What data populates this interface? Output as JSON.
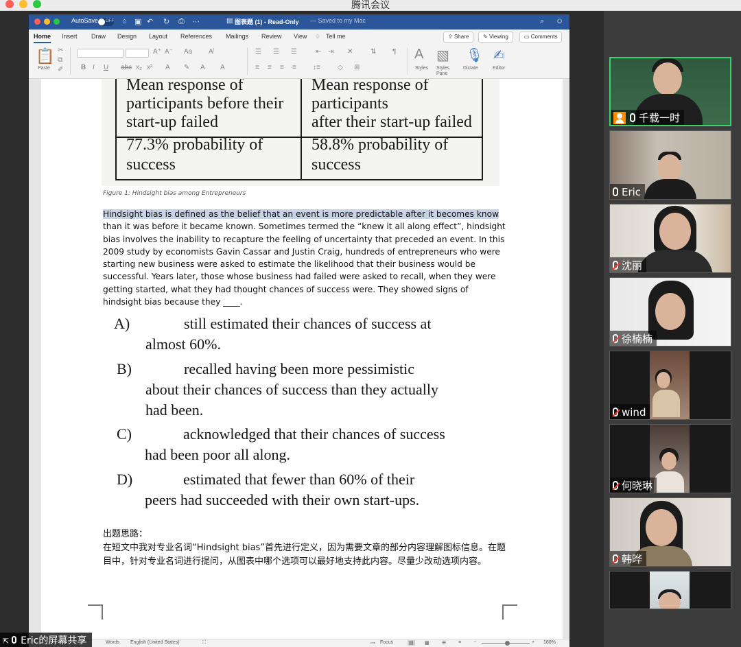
{
  "meeting": {
    "window_title": "腾讯会议",
    "share_label": "Eric的屏幕共享"
  },
  "word": {
    "autosave": "AutoSave",
    "autosave_state": "OFF",
    "doc_title": "图表题 (1)  -  Read-Only",
    "saved_state": "— Saved to my Mac",
    "tabs": [
      "Home",
      "Insert",
      "Draw",
      "Design",
      "Layout",
      "References",
      "Mailings",
      "Review",
      "View"
    ],
    "tell_me": "Tell me",
    "share_btn": "Share",
    "viewing_btn": "Viewing",
    "comments_btn": "Comments",
    "ribbon": {
      "paste": "Paste",
      "styles": "Styles",
      "styles_pane": "Styles\nPane",
      "dictate": "Dictate",
      "editor": "Editor"
    },
    "status": {
      "words": "Words",
      "language": "English (United States)",
      "focus": "Focus",
      "zoom": "180%"
    }
  },
  "document": {
    "table": {
      "before_header": "Mean response of\nparticipants before their\nstart-up failed",
      "after_header": "Mean response of\nparticipants\nafter their start-up failed",
      "before_value": "77.3% probability of\nsuccess",
      "after_value": "58.8% probability of\nsuccess"
    },
    "caption": "Figure 1: Hindsight bias among Entrepreneurs",
    "para_highlight": "Hindsight bias is defined as the belief that an event is more predictable after it becomes know",
    "para_rest": " than it was before it became known. Sometimes termed the “knew it all along effect”, hindsight bias involves the inability to recapture the feeling of uncertainty that preceded an event. In this 2009 study by economists Gavin Cassar and Justin Craig, hundreds of entrepreneurs who were starting new business were asked to estimate the likelihood that their business would be successful. Years later, those whose business had failed were asked to recall, when they were getting started, what they had thought chances of success were. They showed signs of hindsight bias because they ____.",
    "options": [
      {
        "letter": "A)",
        "line1": "still estimated their chances of success at",
        "line2": "almost 60%."
      },
      {
        "letter": "B)",
        "line1": "recalled having been more pessimistic",
        "line2": "about their chances of success than they actually",
        "line3": "had been."
      },
      {
        "letter": "C)",
        "line1": "acknowledged that their chances of success",
        "line2": "had been poor all along."
      },
      {
        "letter": "D)",
        "line1": "estimated that fewer than 60% of their",
        "line2": "peers had succeeded with their own start-ups."
      }
    ],
    "notes_title": "出题思路：",
    "notes_body": "在短文中我对专业名词“Hindsight bias”首先进行定义，因为需要文章的部分内容理解图标信息。在题目中，针对专业名词进行提问，从图表中哪个选项可以最好地支持此内容。尽量少改动选项内容。"
  },
  "participants": [
    {
      "name": "千载一时",
      "muted": false,
      "host": true
    },
    {
      "name": "Eric",
      "muted": false
    },
    {
      "name": "沈丽",
      "muted": true
    },
    {
      "name": "徐楠楠",
      "muted": true
    },
    {
      "name": "wind",
      "muted": true
    },
    {
      "name": "何晓琳",
      "muted": true
    },
    {
      "name": "韩晔",
      "muted": true
    }
  ]
}
